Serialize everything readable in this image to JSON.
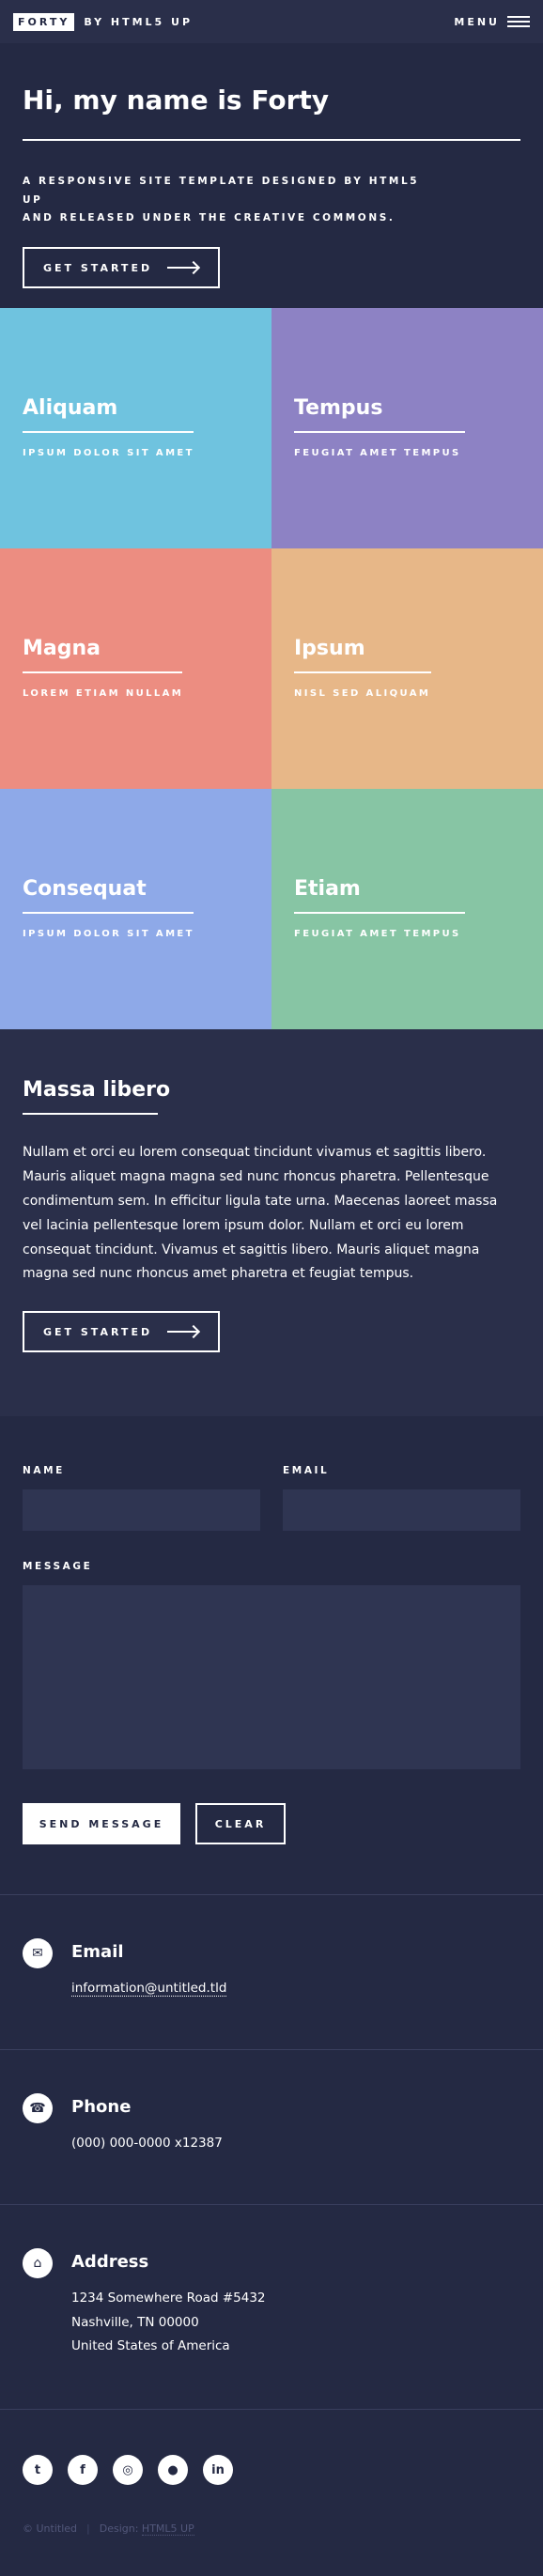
{
  "header": {
    "logo_box": "FORTY",
    "logo_text": "BY HTML5 UP",
    "menu_label": "MENU"
  },
  "banner": {
    "title": "Hi, my name is Forty",
    "subtitle_line1": "A RESPONSIVE SITE TEMPLATE DESIGNED BY HTML5 UP",
    "subtitle_line2": "AND RELEASED UNDER THE CREATIVE COMMONS.",
    "button_label": "GET STARTED"
  },
  "tiles": [
    {
      "title": "Aliquam",
      "caption": "IPSUM DOLOR SIT AMET",
      "color": "#6fc3df"
    },
    {
      "title": "Tempus",
      "caption": "FEUGIAT AMET TEMPUS",
      "color": "#8d82c4"
    },
    {
      "title": "Magna",
      "caption": "LOREM ETIAM NULLAM",
      "color": "#ec8d81"
    },
    {
      "title": "Ipsum",
      "caption": "NISL SED ALIQUAM",
      "color": "#e7b788"
    },
    {
      "title": "Consequat",
      "caption": "IPSUM DOLOR SIT AMET",
      "color": "#8ea9e8"
    },
    {
      "title": "Etiam",
      "caption": "FEUGIAT AMET TEMPUS",
      "color": "#87c5a4"
    }
  ],
  "about": {
    "heading": "Massa libero",
    "body": "Nullam et orci eu lorem consequat tincidunt vivamus et sagittis libero. Mauris aliquet magna magna sed nunc rhoncus pharetra. Pellentesque condimentum sem. In efficitur ligula tate urna. Maecenas laoreet massa vel lacinia pellentesque lorem ipsum dolor. Nullam et orci eu lorem consequat tincidunt. Vivamus et sagittis libero. Mauris aliquet magna magna sed nunc rhoncus amet pharetra et feugiat tempus.",
    "button_label": "GET STARTED"
  },
  "form": {
    "name_label": "NAME",
    "email_label": "EMAIL",
    "message_label": "MESSAGE",
    "send_label": "SEND MESSAGE",
    "clear_label": "CLEAR"
  },
  "contact": {
    "email": {
      "label": "Email",
      "value": "information@untitled.tld",
      "icon": "envelope-icon"
    },
    "phone": {
      "label": "Phone",
      "value": "(000) 000-0000 x12387",
      "icon": "phone-icon"
    },
    "address": {
      "label": "Address",
      "line1": "1234 Somewhere Road #5432",
      "line2": "Nashville, TN 00000",
      "line3": "United States of America",
      "icon": "home-icon"
    }
  },
  "footer": {
    "social_icons": [
      "twitter-icon",
      "facebook-icon",
      "instagram-icon",
      "github-icon",
      "linkedin-icon"
    ],
    "copyright": "© Untitled",
    "design_prefix": "Design:",
    "design_link": "HTML5 UP"
  },
  "colors": {
    "background": "#242943",
    "panel": "#2a2f4a",
    "input": "#2f3552"
  }
}
